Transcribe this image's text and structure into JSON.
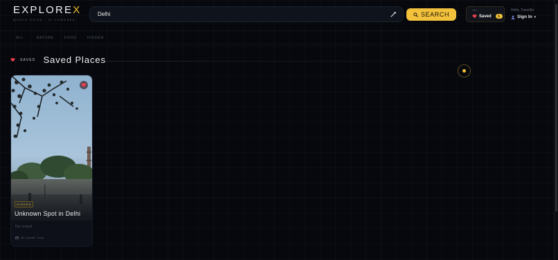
{
  "brand": {
    "name_main": "EXPLORE",
    "name_accent": "X",
    "tagline": "WORLD GUIDE · AI POWERED"
  },
  "search": {
    "value": "Delhi",
    "button_label": "SEARCH"
  },
  "saved_button": {
    "caption": "Your",
    "label": "Saved",
    "count": "1"
  },
  "user": {
    "greeting": "Hello, Traveller",
    "signin_label": "Sign In"
  },
  "filters": [
    "ALL",
    "NATURE",
    "FOOD",
    "HIDDEN"
  ],
  "section": {
    "eyebrow": "SAVED",
    "title": "Saved Places"
  },
  "cards": [
    {
      "badge": "HIDDEN",
      "title": "Unknown Spot in Delhi",
      "description": "No crowd",
      "meta": "All 1 people · local"
    }
  ],
  "colors": {
    "accent": "#f2bf2e",
    "heart": "#e5404f",
    "background": "#06080d"
  },
  "icons": [
    "search-icon",
    "mic-icon",
    "heart-icon",
    "user-icon",
    "chevron-down-icon",
    "location-dot-icon",
    "calendar-icon"
  ]
}
